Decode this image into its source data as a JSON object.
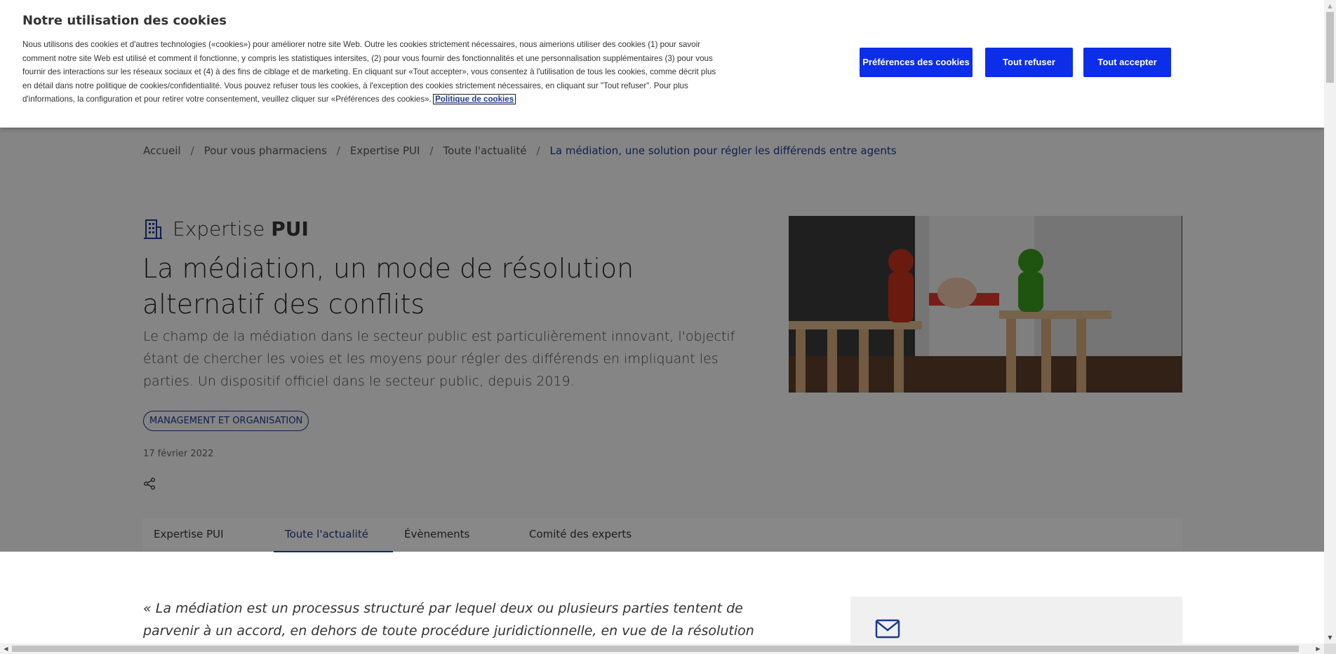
{
  "cookie": {
    "title": "Notre utilisation des cookies",
    "text": "Nous utilisons des cookies et d'autres technologies («cookies») pour améliorer notre site Web. Outre les cookies strictement nécessaires, nous aimerions utiliser des cookies (1) pour savoir comment notre site Web est utilisé et comment il fonctionne, y compris les statistiques intersites, (2) pour vous fournir des fonctionnalités et une personnalisation supplémentaires (3) pour vous fournir des interactions sur les réseaux sociaux et (4) à des fins de ciblage et de marketing. En cliquant sur «Tout accepter», vous consentez à l'utilisation de tous les cookies, comme décrit plus en détail dans notre politique de cookies/confidentialité. Vous pouvez refuser tous les cookies, à l'exception des cookies strictement nécessaires, en cliquant sur \"Tout refuser\". Pour plus d'informations, la configuration et pour retirer votre consentement, veuillez cliquer sur «Préférences des cookies».",
    "policy_link": "Politique de cookies",
    "preferences_button": "Préférences des cookies",
    "refuse_button": "Tout refuser",
    "accept_button": "Tout accepter",
    "button_color": "#0d2ee8"
  },
  "breadcrumb": {
    "items": [
      "Accueil",
      "Pour vous pharmaciens",
      "Expertise PUI",
      "Toute l'actualité"
    ],
    "separator": "/",
    "current": "La médiation, une solution pour régler les différends entre agents"
  },
  "article": {
    "section_icon": "building-icon",
    "section_prefix": "Expertise",
    "section_name": "PUI",
    "title": "La médiation, un mode de résolution alternatif des conflits",
    "lead": "Le champ de la médiation dans le secteur public est particulièrement innovant, l'objectif étant de chercher les voies et les moyens pour régler des différends en impliquant les parties. Un dispositif officiel dans le secteur public, depuis 2019.",
    "tag": "MANAGEMENT ET ORGANISATION",
    "date": "17 février 2022",
    "share_icon": "share-icon",
    "image_icon": "hero-image"
  },
  "tabs": [
    {
      "label": "Expertise PUI",
      "active": false
    },
    {
      "label": "Toute l'actualité",
      "active": true
    },
    {
      "label": "Évènements",
      "active": false
    },
    {
      "label": "Comité des experts",
      "active": false
    }
  ],
  "body": {
    "quote": "« La médiation est un processus structuré par lequel deux ou plusieurs parties tentent de parvenir à un accord, en dehors de toute procédure juridictionnelle, en vue de la résolution amiable de leur différend ou du conflit qui les",
    "mail_icon": "mail-icon"
  },
  "colors": {
    "brand_blue": "#1e3a8a",
    "accent_button": "#0d2ee8"
  }
}
